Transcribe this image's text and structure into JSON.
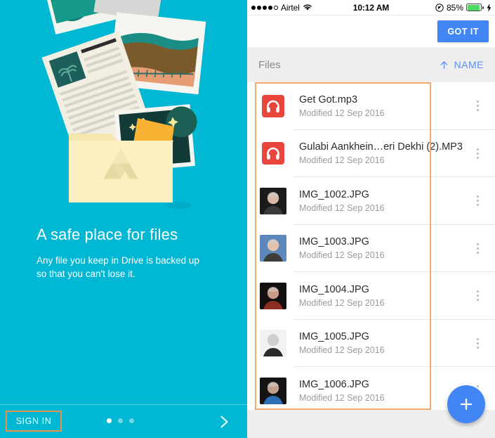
{
  "onboarding": {
    "title": "A safe place for files",
    "subtitle": "Any file you keep in Drive is backed up so that you can't lose it.",
    "sign_in_label": "SIGN IN",
    "dots_total": 3,
    "dots_active_index": 0,
    "next_icon": "chevron-right-icon",
    "background_color": "#00b8d4",
    "sign_in_highlight_color": "#e8924a",
    "illustration": {
      "name": "folder-with-files-illustration",
      "folder_color": "#fdf0c0",
      "drive_logo_color": "#eee3b4"
    }
  },
  "status_bar": {
    "signal_dots_filled": 4,
    "signal_dots_empty": 1,
    "carrier": "Airtel",
    "wifi_icon": "wifi-icon",
    "time": "10:12 AM",
    "location_icon": "location-services-icon",
    "battery_percent": "85%",
    "battery_level": 85,
    "battery_color": "#4cd964",
    "charging_icon": "lightning-bolt-icon"
  },
  "app": {
    "got_it_label": "GOT IT",
    "got_it_color": "#4285f4",
    "files_header_label": "Files",
    "sort_label": "NAME",
    "sort_direction_icon": "arrow-up-icon",
    "sort_color": "#5b8dee",
    "fab_icon": "plus-icon",
    "fab_color": "#4285f4",
    "overflow_icon": "more-vertical-icon",
    "annotation_color": "#f5a86a"
  },
  "files": [
    {
      "name": "Get Got.mp3",
      "modified": "Modified 12 Sep 2016",
      "thumb_type": "audio",
      "icon": "headphones-icon"
    },
    {
      "name": "Gulabi Aankhein…eri Dekhi (2).MP3",
      "modified": "Modified 12 Sep 2016",
      "thumb_type": "audio",
      "icon": "headphones-icon"
    },
    {
      "name": "IMG_1002.JPG",
      "modified": "Modified 12 Sep 2016",
      "thumb_type": "photo",
      "icon": "photo-thumbnail",
      "palette": [
        "#1b1b1b",
        "#d8b9a6",
        "#3a3a3a"
      ]
    },
    {
      "name": "IMG_1003.JPG",
      "modified": "Modified 12 Sep 2016",
      "thumb_type": "photo",
      "icon": "photo-thumbnail",
      "palette": [
        "#5d88bb",
        "#e3c3ad",
        "#3d3c38"
      ]
    },
    {
      "name": "IMG_1004.JPG",
      "modified": "Modified 12 Sep 2016",
      "thumb_type": "photo",
      "icon": "photo-thumbnail",
      "palette": [
        "#120f0e",
        "#c99a84",
        "#8c2f22"
      ]
    },
    {
      "name": "IMG_1005.JPG",
      "modified": "Modified 12 Sep 2016",
      "thumb_type": "photo",
      "icon": "photo-thumbnail",
      "palette": [
        "#f2f2f2",
        "#cfcfcf",
        "#2a2a2a"
      ]
    },
    {
      "name": "IMG_1006.JPG",
      "modified": "Modified 12 Sep 2016",
      "thumb_type": "photo",
      "icon": "photo-thumbnail",
      "palette": [
        "#141414",
        "#c3a08c",
        "#2f6fb5"
      ]
    }
  ]
}
